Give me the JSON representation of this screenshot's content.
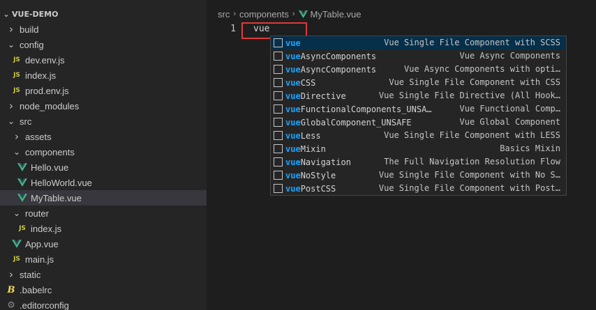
{
  "explorer": {
    "section_title": "VUE-DEMO",
    "items": [
      {
        "label": "build",
        "type": "folder",
        "expanded": false,
        "indent": 1
      },
      {
        "label": "config",
        "type": "folder",
        "expanded": true,
        "indent": 1
      },
      {
        "label": "dev.env.js",
        "type": "js",
        "indent": 2
      },
      {
        "label": "index.js",
        "type": "js",
        "indent": 2
      },
      {
        "label": "prod.env.js",
        "type": "js",
        "indent": 2
      },
      {
        "label": "node_modules",
        "type": "folder",
        "expanded": false,
        "indent": 1
      },
      {
        "label": "src",
        "type": "folder",
        "expanded": true,
        "indent": 1
      },
      {
        "label": "assets",
        "type": "folder",
        "expanded": false,
        "indent": 2
      },
      {
        "label": "components",
        "type": "folder",
        "expanded": true,
        "indent": 2
      },
      {
        "label": "Hello.vue",
        "type": "vue",
        "indent": 3
      },
      {
        "label": "HelloWorld.vue",
        "type": "vue",
        "indent": 3
      },
      {
        "label": "MyTable.vue",
        "type": "vue",
        "indent": 3,
        "selected": true
      },
      {
        "label": "router",
        "type": "folder",
        "expanded": true,
        "indent": 2
      },
      {
        "label": "index.js",
        "type": "js",
        "indent": 3
      },
      {
        "label": "App.vue",
        "type": "vue",
        "indent": 2
      },
      {
        "label": "main.js",
        "type": "js",
        "indent": 2
      },
      {
        "label": "static",
        "type": "folder",
        "expanded": false,
        "indent": 1
      },
      {
        "label": ".babelrc",
        "type": "babel",
        "indent": 1
      },
      {
        "label": ".editorconfig",
        "type": "gear",
        "indent": 1
      }
    ]
  },
  "breadcrumb": {
    "parts": [
      "src",
      "components",
      "MyTable.vue"
    ]
  },
  "editor": {
    "line_number": "1",
    "line_text": "vue"
  },
  "suggestions": {
    "query": "vue",
    "items": [
      {
        "label": "vue",
        "detail": "Vue Single File Component with SCSS",
        "active": true
      },
      {
        "label": "vueAsyncComponents",
        "detail": "Vue Async Components"
      },
      {
        "label": "vueAsyncComponents",
        "detail": "Vue Async Components with opti…"
      },
      {
        "label": "vueCSS",
        "detail": "Vue Single File Component with CSS"
      },
      {
        "label": "vueDirective",
        "detail": "Vue Single File Directive (All Hook…"
      },
      {
        "label": "vueFunctionalComponents_UNSA…",
        "detail": "Vue Functional Comp…"
      },
      {
        "label": "vueGlobalComponent_UNSAFE",
        "detail": "Vue Global Component"
      },
      {
        "label": "vueLess",
        "detail": "Vue Single File Component with LESS"
      },
      {
        "label": "vueMixin",
        "detail": "Basics Mixin"
      },
      {
        "label": "vueNavigation",
        "detail": "The Full Navigation Resolution Flow"
      },
      {
        "label": "vueNoStyle",
        "detail": "Vue Single File Component with No S…"
      },
      {
        "label": "vuePostCSS",
        "detail": "Vue Single File Component with Post…"
      }
    ]
  },
  "colors": {
    "vue_icon": "#41b883",
    "match_highlight": "#18a3ff",
    "highlight_box": "#e03a3a",
    "selected_row": "#37373d",
    "suggest_active": "#062f4a"
  }
}
